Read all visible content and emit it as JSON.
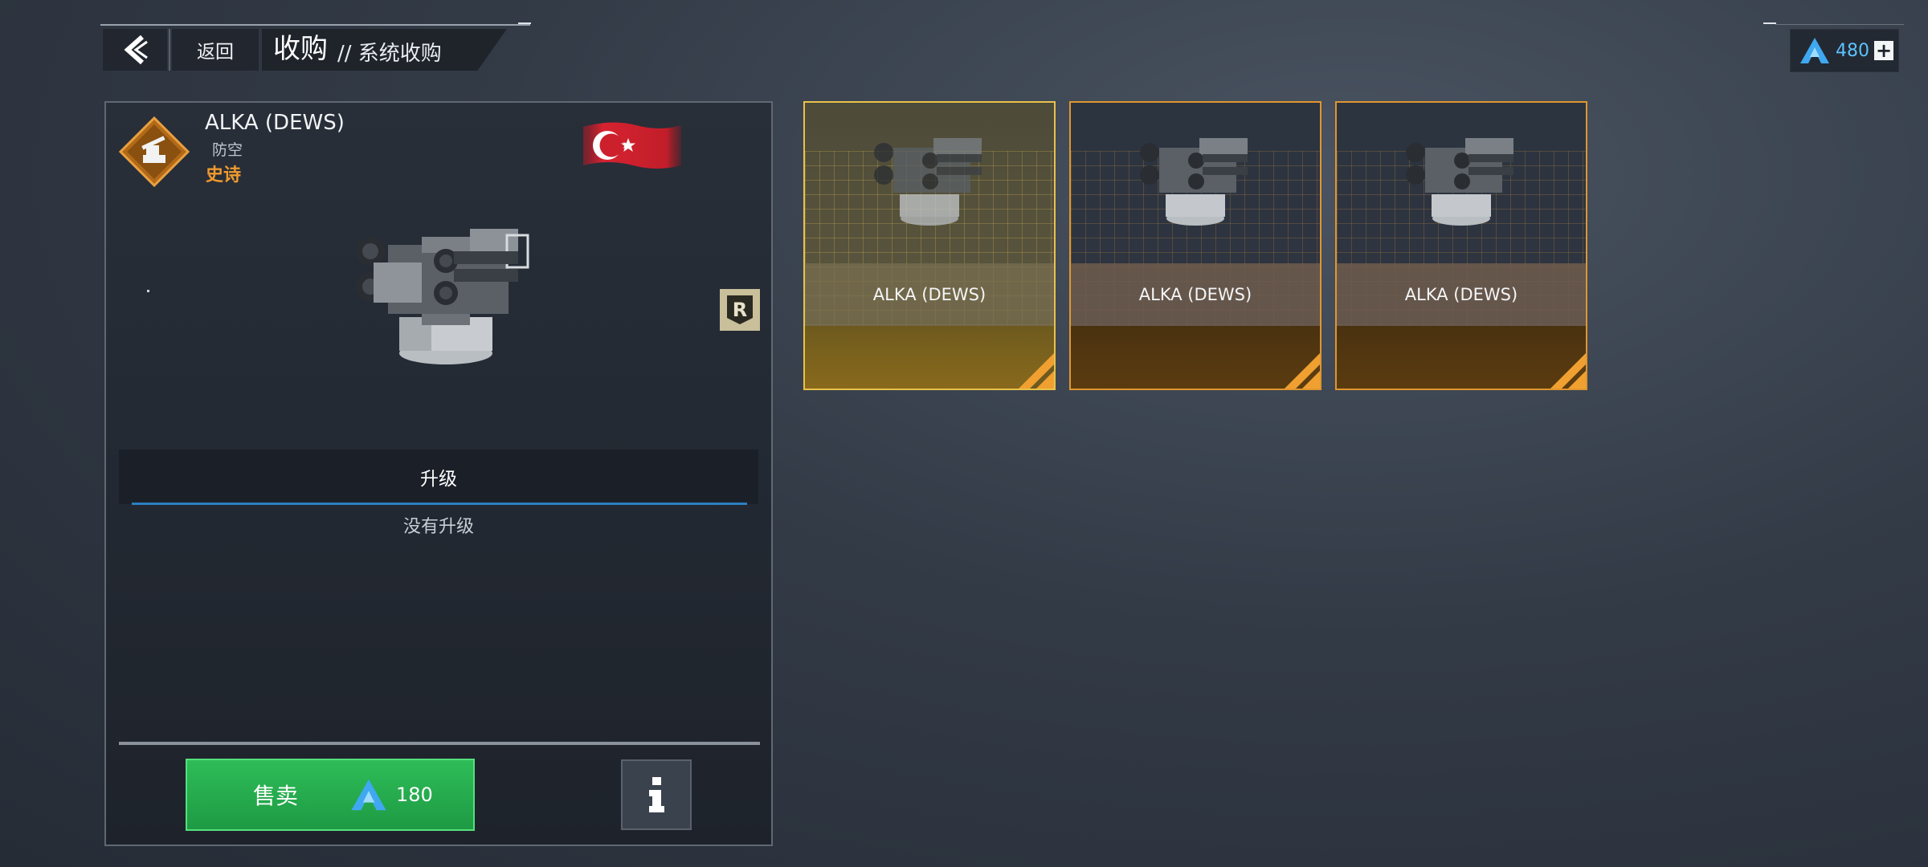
{
  "header": {
    "back_label": "返回",
    "title": "收购",
    "subtitle": "// 系统收购"
  },
  "currency": {
    "amount": "480"
  },
  "item": {
    "name": "ALKA (DEWS)",
    "type": "防空",
    "rarity": "史诗",
    "upgrade_tab": "升级",
    "no_upgrade": "没有升级",
    "sell_label": "售卖",
    "sell_price": "180"
  },
  "cards": [
    {
      "name": "ALKA (DEWS)",
      "selected": true
    },
    {
      "name": "ALKA (DEWS)",
      "selected": false
    },
    {
      "name": "ALKA (DEWS)",
      "selected": false
    }
  ],
  "colors": {
    "rarity": "#f09a2e",
    "sell_green": "#2ebd58",
    "currency_blue": "#5cc2ff",
    "selected_border": "#e8c24a",
    "card_border": "#e0962e"
  },
  "icons": [
    "chevron-left-icon",
    "currency-icon",
    "plus-icon",
    "anti-air-turret-icon",
    "turkey-flag-icon",
    "rank-r-icon",
    "info-icon"
  ]
}
